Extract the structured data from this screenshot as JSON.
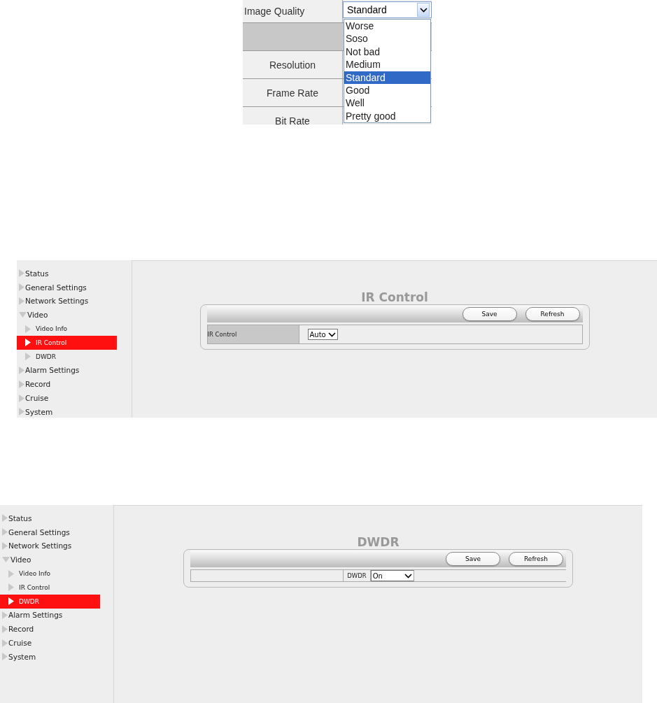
{
  "quality_panel": {
    "rows": [
      {
        "kind": "field",
        "label": "Image Quality"
      },
      {
        "kind": "section"
      },
      {
        "kind": "field",
        "label": "Resolution"
      },
      {
        "kind": "field",
        "label": "Frame Rate"
      },
      {
        "kind": "field",
        "label": "Bit Rate"
      }
    ],
    "dropdown": {
      "value": "Standard",
      "expanded": true,
      "options": [
        {
          "label": "Worse",
          "selected": false
        },
        {
          "label": "Soso",
          "selected": false
        },
        {
          "label": "Not bad",
          "selected": false
        },
        {
          "label": "Medium",
          "selected": false
        },
        {
          "label": "Standard",
          "selected": true
        },
        {
          "label": "Good",
          "selected": false
        },
        {
          "label": "Well",
          "selected": false
        },
        {
          "label": "Pretty good",
          "selected": false
        }
      ]
    }
  },
  "settings_pages": [
    {
      "sidebar": {
        "items": [
          {
            "label": "Status",
            "expanded": false,
            "selected": false
          },
          {
            "label": "General Settings",
            "expanded": false,
            "selected": false
          },
          {
            "label": "Network Settings",
            "expanded": false,
            "selected": false
          },
          {
            "label": "Video",
            "expanded": true,
            "selected": false,
            "children": [
              {
                "label": "Video Info",
                "selected": false
              },
              {
                "label": "IR Control",
                "selected": true
              },
              {
                "label": "DWDR",
                "selected": false
              }
            ]
          },
          {
            "label": "Alarm Settings",
            "expanded": false,
            "selected": false
          },
          {
            "label": "Record",
            "expanded": false,
            "selected": false
          },
          {
            "label": "Cruise",
            "expanded": false,
            "selected": false
          },
          {
            "label": "System",
            "expanded": false,
            "selected": false
          }
        ]
      },
      "title": "IR Control",
      "buttons": [
        "Save",
        "Refresh"
      ],
      "field": {
        "kind": "split",
        "label": "IR Control",
        "value": "Auto"
      }
    },
    {
      "sidebar": {
        "items": [
          {
            "label": "Status",
            "expanded": false,
            "selected": false
          },
          {
            "label": "General Settings",
            "expanded": false,
            "selected": false
          },
          {
            "label": "Network Settings",
            "expanded": false,
            "selected": false
          },
          {
            "label": "Video",
            "expanded": true,
            "selected": false,
            "children": [
              {
                "label": "Video Info",
                "selected": false
              },
              {
                "label": "IR Control",
                "selected": false
              },
              {
                "label": "DWDR",
                "selected": true
              }
            ]
          },
          {
            "label": "Alarm Settings",
            "expanded": false,
            "selected": false
          },
          {
            "label": "Record",
            "expanded": false,
            "selected": false
          },
          {
            "label": "Cruise",
            "expanded": false,
            "selected": false
          },
          {
            "label": "System",
            "expanded": false,
            "selected": false
          }
        ]
      },
      "title": "DWDR",
      "buttons": [
        "Save",
        "Refresh"
      ],
      "field": {
        "kind": "centered",
        "label": "DWDR",
        "value": "On"
      }
    }
  ]
}
